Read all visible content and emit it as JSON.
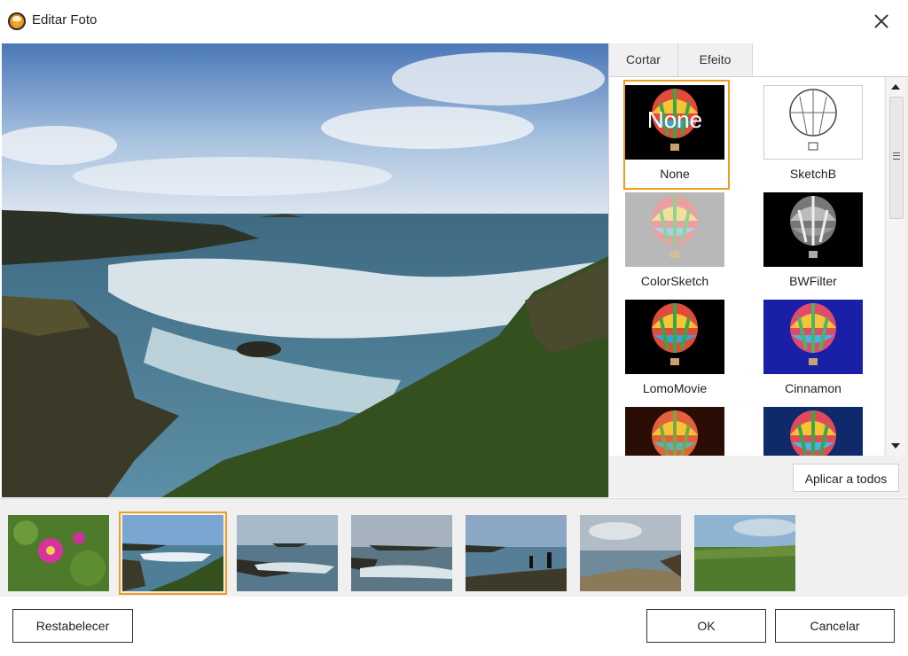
{
  "window": {
    "title": "Editar Foto",
    "icon": "app-logo-icon",
    "close_icon": "close-icon"
  },
  "tabs": [
    {
      "label": "Cortar"
    },
    {
      "label": "Efeito"
    }
  ],
  "effects": [
    {
      "label": "None",
      "overlay": "None",
      "selected": true
    },
    {
      "label": "SketchB"
    },
    {
      "label": "ColorSketch"
    },
    {
      "label": "BWFilter"
    },
    {
      "label": "LomoMovie"
    },
    {
      "label": "Cinnamon"
    },
    {
      "label": ""
    },
    {
      "label": ""
    }
  ],
  "apply_all_label": "Aplicar a todos",
  "filmstrip_selected_index": 1,
  "buttons": {
    "reset": "Restabelecer",
    "ok": "OK",
    "cancel": "Cancelar"
  },
  "colors": {
    "accent": "#f29b1c"
  }
}
